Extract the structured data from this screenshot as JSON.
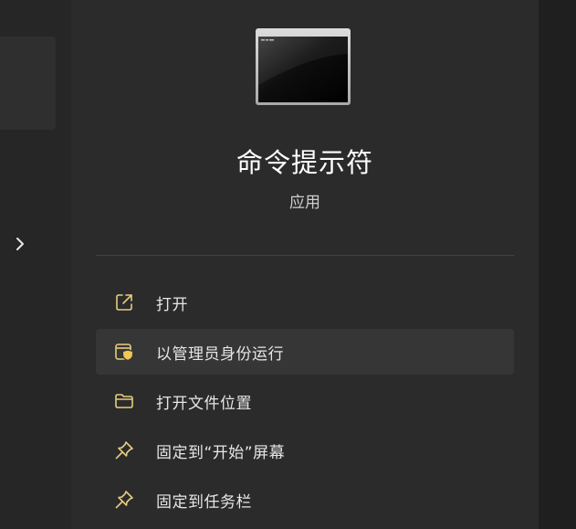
{
  "app": {
    "name": "命令提示符",
    "type": "应用",
    "icon": "terminal-icon"
  },
  "left_pane": {
    "expand_icon": "chevron-right-icon"
  },
  "menu": {
    "items": [
      {
        "label": "打开",
        "icon": "open-external-icon"
      },
      {
        "label": "以管理员身份运行",
        "icon": "run-as-admin-shield-icon"
      },
      {
        "label": "打开文件位置",
        "icon": "folder-icon"
      },
      {
        "label": "固定到“开始”屏幕",
        "icon": "pin-icon"
      },
      {
        "label": "固定到任务栏",
        "icon": "pin-icon"
      }
    ]
  },
  "colors": {
    "icon_accent": "#e6cd7e",
    "shield_accent": "#f0c659",
    "text": "#e6e6e6"
  }
}
